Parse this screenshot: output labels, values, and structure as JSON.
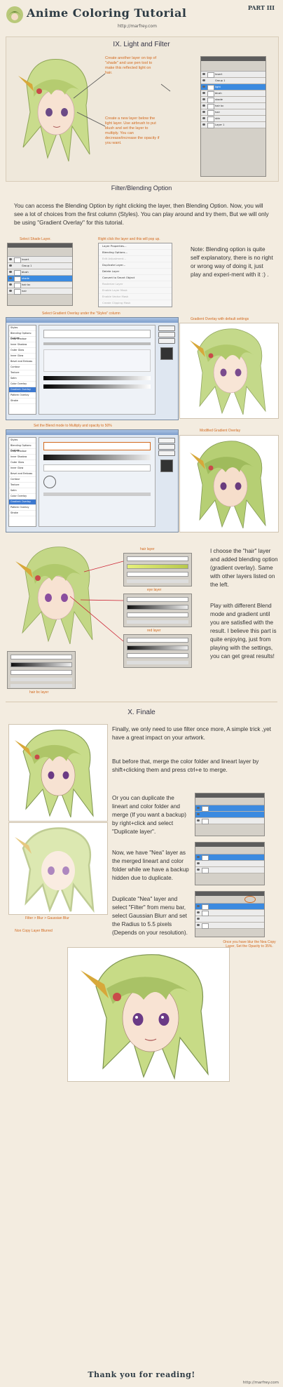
{
  "header": {
    "title": "Anime Coloring Tutorial",
    "part": "PART III",
    "url": "http://marfrey.com"
  },
  "section9": {
    "title": "IX. Light and Filter",
    "note_top": "Create another layer on top of \"shade\" and use pen tool to make this reflected light on hair.",
    "note_bottom": "Create a new layer below the light layer. Use airbrush to put blush and set the layer to multiply. You can decrease/increase the opacity if you want.",
    "layers_panel": [
      "Insert",
      "Group 1",
      "light",
      "blush",
      "shade",
      "hair bc",
      "hair",
      "skin",
      "Layer 1"
    ]
  },
  "filter_blending": {
    "title": "Filter/Blending Option",
    "intro": "You can access the Blending Option by right clicking the layer, then Blending Option. Now, you will see a lot of choices from the first column (Styles). You can play around and try them, But we will only be using \"Gradient Overlay\" for this tutorial.",
    "cap_select": "Select Shade Layer.",
    "cap_right_click": "Right click the layer and this will pop up.",
    "context_menu": [
      "Layer Properties...",
      "Blending Options...",
      "Edit Adjustment...",
      "Duplicate Layer...",
      "Delete Layer",
      "Convert to Smart Object",
      "Rasterize Layer",
      "Enable Layer Mask",
      "Enable Vector Mask",
      "Create Clipping Mask"
    ],
    "side_note": "Note: Blending option is quite self explanatory, there is no right or wrong way of doing it, just play and experi-ment with it :) .",
    "cap_select_gradient": "Select Gradient Overlay under the \"Styles\" column",
    "cap_default": "Gradient Overlay with default settings",
    "cap_blend_mode": "Set the Blend mode to Multiply and opacity to 50%",
    "cap_modified": "Modified Gradient Overlay",
    "styles_list": [
      "Styles",
      "Blending Options: Custom",
      "Drop Shadow",
      "Inner Shadow",
      "Outer Glow",
      "Inner Glow",
      "Bevel and Emboss",
      "Contour",
      "Texture",
      "Satin",
      "Color Overlay",
      "Gradient Overlay",
      "Pattern Overlay",
      "Stroke"
    ],
    "dialog_buttons": [
      "OK",
      "Cancel",
      "New Style...",
      "Preview"
    ]
  },
  "hair_eye": {
    "cap_hair_layer": "hair layer",
    "cap_eye_layer": "eye layer",
    "cap_red_layer": "red layer",
    "cap_hair_bc": "hair bc layer",
    "para1": "I choose the \"hair\" layer and added blending option (gradient overlay). Same with other layers listed on the left.",
    "para2": "Play with different Blend mode and gradient until you are satisfied with the result. I believe this part is quite enjoying, just from playing with the settings, you can get great results!"
  },
  "section10": {
    "title": "X. Finale",
    "p1": "Finally, we only need to use filter once more, A simple trick ,yet have a great impact on your artwork.",
    "p2": "But before that, merge the color folder and lineart layer by shift+clicking them and press ctrl+e to merge.",
    "p3": "Or you can duplicate the lineart and color folder and merge (If you want a backup) by right+click and select \"Duplicate layer\".",
    "p4": "Now, we have \"Nea\" layer as the merged lineart and color folder while we have a backup hidden due to duplicate.",
    "p5": "Duplicate \"Nea\" layer and select \"Filter\" from menu bar, select Gaussian Blurr and set the Radius to 5.5 pixels (Depends on your resolution).",
    "cap_filter": "Filter > Blur > Gaussian Blur",
    "cap_noncopy": "Non Copy Layer Blurred",
    "cap_opacity": "Once you have blur the Nea Copy Layer, Set the Opacity to 35%."
  },
  "footer": {
    "thanks": "Thank you for reading!",
    "url": "http://marfrey.com"
  },
  "colors": {
    "accent": "#d2691e",
    "hair": "#c6d98a",
    "background": "#f3ece0"
  }
}
